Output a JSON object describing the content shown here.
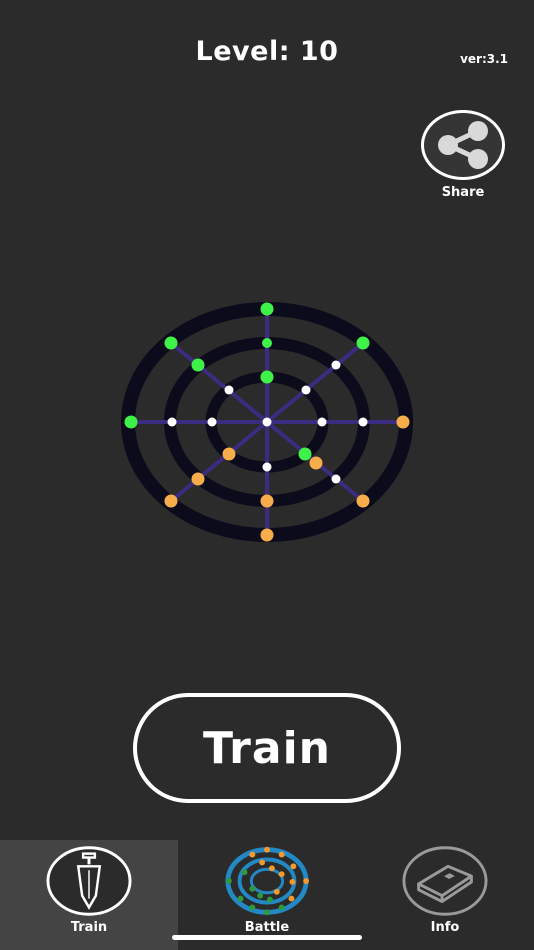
{
  "header": {
    "level_title": "Level: 10",
    "version": "ver:3.1"
  },
  "share": {
    "label": "Share",
    "icon": "share-icon"
  },
  "board": {
    "rings": 3,
    "spokes": 8,
    "colors": {
      "ring": "#0c0b1c",
      "spoke": "#3b2c82",
      "empty_node": "#ffffff",
      "green_piece": "#3ff24a",
      "orange_piece": "#f6ad4a"
    }
  },
  "main_action": {
    "label": "Train"
  },
  "tabbar": {
    "tabs": [
      {
        "label": "Train",
        "icon": "sword-icon",
        "active": true
      },
      {
        "label": "Battle",
        "icon": "board-icon",
        "active": false
      },
      {
        "label": "Info",
        "icon": "book-icon",
        "active": false
      }
    ]
  }
}
